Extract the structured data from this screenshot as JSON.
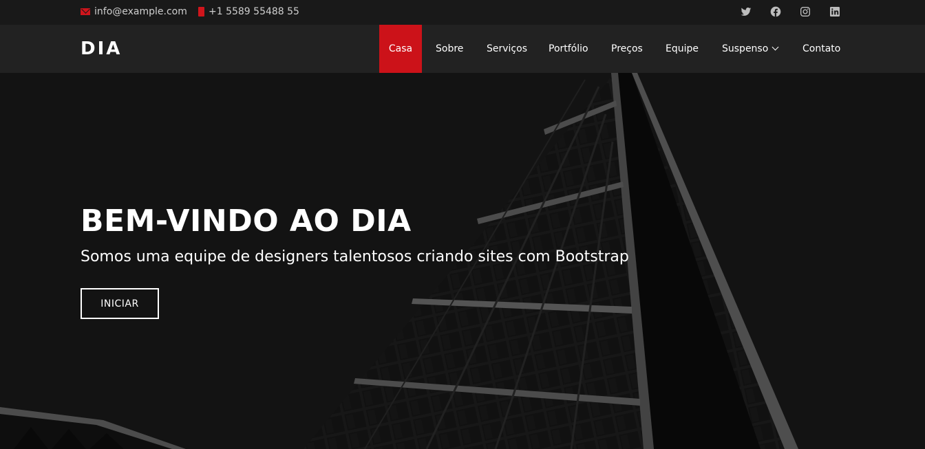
{
  "topbar": {
    "email": "info@example.com",
    "phone": "+1 5589 55488 55",
    "social": [
      "twitter-icon",
      "facebook-icon",
      "instagram-icon",
      "linkedin-icon"
    ]
  },
  "header": {
    "logo": "DIA",
    "nav": {
      "casa": "Casa",
      "sobre": "Sobre",
      "servicos": "Serviços",
      "portfolio": "Portfólio",
      "precos": "Preços",
      "equipe": "Equipe",
      "suspenso": "Suspenso",
      "contato": "Contato"
    }
  },
  "hero": {
    "title": "BEM-VINDO AO DIA",
    "subtitle": "Somos uma equipe de designers talentosos criando sites com Bootstrap",
    "button": "INICIAR"
  },
  "colors": {
    "accent": "#cc1219",
    "topbar": "#191919",
    "header": "#222222"
  }
}
